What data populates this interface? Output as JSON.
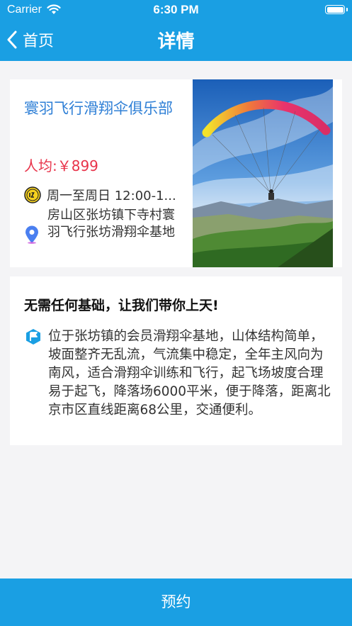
{
  "status_bar": {
    "carrier": "Carrier",
    "time": "6:30 PM"
  },
  "nav": {
    "back_label": "首页",
    "title": "详情"
  },
  "club": {
    "name": "寰羽飞行滑翔伞俱乐部",
    "price": "人均:￥899",
    "hours": "周一至周日 12:00-1...",
    "address": "房山区张坊镇下寺村寰羽飞行张坊滑翔伞基地"
  },
  "intro": {
    "tagline": "无需任何基础，让我们带你上天!",
    "description": "位于张坊镇的会员滑翔伞基地，山体结构简单，坡面整齐无乱流，气流集中稳定，全年主风向为南风，适合滑翔伞训练和飞行，起飞场坡度合理易于起飞，降落场6000平米，便于降落，距离北京市区直线距离68公里，交通便利。"
  },
  "footer": {
    "book_label": "预约"
  },
  "colors": {
    "accent": "#1a9fe3",
    "title_blue": "#2e7fd6",
    "price_red": "#e8334a",
    "background": "#f4f4f6"
  },
  "icons": {
    "back": "chevron-left-icon",
    "clock": "clock-icon",
    "location": "location-pin-icon",
    "flag": "flag-icon",
    "wifi": "wifi-icon",
    "battery": "battery-icon"
  }
}
